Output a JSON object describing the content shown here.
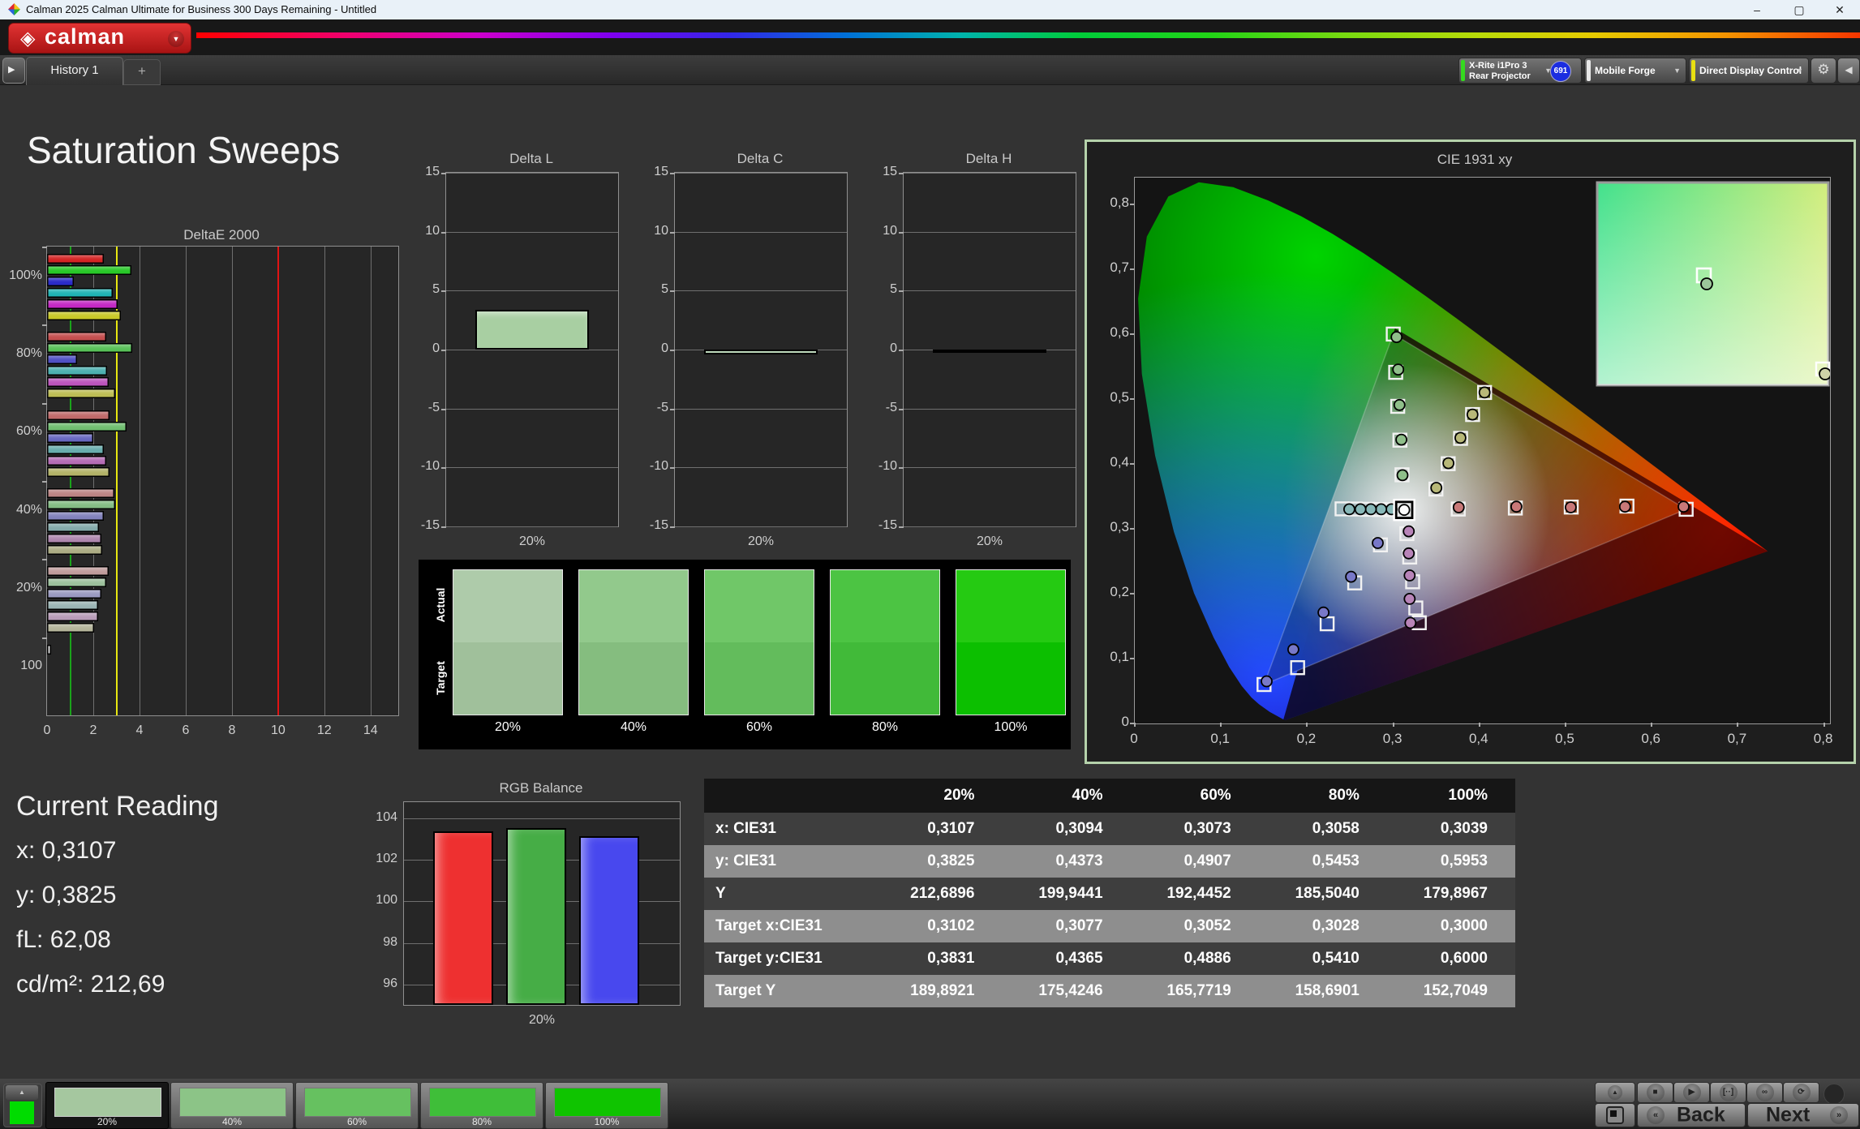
{
  "window": {
    "title": "Calman 2025 Calman Ultimate for Business 300 Days Remaining  - Untitled",
    "minimize_icon": "–",
    "maximize_icon": "▢",
    "close_icon": "✕"
  },
  "brand": {
    "name": "calman",
    "diamond_icon": "◈",
    "dropdown_icon": "▼"
  },
  "toolbar": {
    "expand_icon": "▶",
    "history_tab": "History 1",
    "add_tab": "+",
    "meter": {
      "line1": "X-Rite i1Pro 3",
      "line2": "Rear Projector",
      "badge": "691",
      "stripe_color": "#35d91f"
    },
    "source": {
      "label": "Mobile Forge",
      "stripe_color": "#e8e8e8"
    },
    "display_control": {
      "label": "Direct Display Control",
      "stripe_color": "#e8df12"
    },
    "settings_icon": "⚙",
    "collapse_icon": "◀"
  },
  "page": {
    "title": "Saturation Sweeps"
  },
  "current_reading": {
    "title": "Current Reading",
    "lines": [
      "x: 0,3107",
      "y: 0,3825",
      "fL: 62,08",
      "cd/m²: 212,69"
    ]
  },
  "swatch_compare": {
    "actual_label": "Actual",
    "target_label": "Target",
    "items": [
      {
        "label": "20%",
        "actual": "#aecbaa",
        "target": "#a0c09b"
      },
      {
        "label": "40%",
        "actual": "#92c98c",
        "target": "#85bd7f"
      },
      {
        "label": "60%",
        "actual": "#70c768",
        "target": "#63bc5c"
      },
      {
        "label": "80%",
        "actual": "#4cc443",
        "target": "#41ba39"
      },
      {
        "label": "100%",
        "actual": "#25ca12",
        "target": "#0cbf00"
      }
    ]
  },
  "table": {
    "headers": [
      "",
      "20%",
      "40%",
      "60%",
      "80%",
      "100%"
    ],
    "rows": [
      {
        "label": "x: CIE31",
        "values": [
          "0,3107",
          "0,3094",
          "0,3073",
          "0,3058",
          "0,3039"
        ]
      },
      {
        "label": "y: CIE31",
        "values": [
          "0,3825",
          "0,4373",
          "0,4907",
          "0,5453",
          "0,5953"
        ]
      },
      {
        "label": "Y",
        "values": [
          "212,6896",
          "199,9441",
          "192,4452",
          "185,5040",
          "179,8967"
        ]
      },
      {
        "label": "Target x:CIE31",
        "values": [
          "0,3102",
          "0,3077",
          "0,3052",
          "0,3028",
          "0,3000"
        ]
      },
      {
        "label": "Target y:CIE31",
        "values": [
          "0,3831",
          "0,4365",
          "0,4886",
          "0,5410",
          "0,6000"
        ]
      },
      {
        "label": "Target Y",
        "values": [
          "189,8921",
          "175,4246",
          "165,7719",
          "158,6901",
          "152,7049"
        ]
      }
    ]
  },
  "footer": {
    "swatch_buttons": [
      {
        "label": "20%",
        "color": "#a5c79f",
        "selected": true
      },
      {
        "label": "40%",
        "color": "#8cc487",
        "selected": false
      },
      {
        "label": "60%",
        "color": "#66c160",
        "selected": false
      },
      {
        "label": "80%",
        "color": "#3fbe39",
        "selected": false
      },
      {
        "label": "100%",
        "color": "#0fc400",
        "selected": false
      }
    ],
    "up_icon": "▲",
    "stop_square_icon": "■",
    "transport_icons": [
      {
        "name": "stop",
        "glyph": "■"
      },
      {
        "name": "play",
        "glyph": "▶"
      },
      {
        "name": "read-series",
        "glyph": "[··]"
      },
      {
        "name": "continuous",
        "glyph": "∞"
      },
      {
        "name": "refresh",
        "glyph": "⟳"
      }
    ],
    "back_arrow": "«",
    "back_label": "Back",
    "next_label": "Next",
    "next_arrow": "»",
    "target_color": "#00dc00"
  },
  "chart_data": [
    {
      "id": "deltae2000",
      "type": "bar",
      "orientation": "horizontal",
      "title": "DeltaE 2000",
      "xlim": [
        0,
        15.2
      ],
      "xticks": [
        0,
        2,
        4,
        6,
        8,
        10,
        12,
        14
      ],
      "reference_lines": [
        {
          "value": 1,
          "color": "#1aa31a"
        },
        {
          "value": 3,
          "color": "#e8e810"
        },
        {
          "value": 10,
          "color": "#e01414"
        }
      ],
      "groups": [
        {
          "label": "100%",
          "bars": [
            {
              "name": "red",
              "value": 2.45,
              "color": "#d42424"
            },
            {
              "name": "green",
              "value": 3.65,
              "color": "#28c828"
            },
            {
              "name": "blue",
              "value": 1.15,
              "color": "#2a2ac8"
            },
            {
              "name": "cyan",
              "value": 2.85,
              "color": "#20b4b4"
            },
            {
              "name": "magenta",
              "value": 3.05,
              "color": "#c428c4"
            },
            {
              "name": "yellow",
              "value": 3.2,
              "color": "#c8c828"
            }
          ]
        },
        {
          "label": "80%",
          "bars": [
            {
              "name": "red",
              "value": 2.55,
              "color": "#c44e4e"
            },
            {
              "name": "green",
              "value": 3.7,
              "color": "#58c058"
            },
            {
              "name": "blue",
              "value": 1.3,
              "color": "#5050c4"
            },
            {
              "name": "cyan",
              "value": 2.6,
              "color": "#4cb0b0"
            },
            {
              "name": "magenta",
              "value": 2.65,
              "color": "#bc54bc"
            },
            {
              "name": "yellow",
              "value": 2.95,
              "color": "#bcbc54"
            }
          ]
        },
        {
          "label": "60%",
          "bars": [
            {
              "name": "red",
              "value": 2.7,
              "color": "#c06a6a"
            },
            {
              "name": "green",
              "value": 3.45,
              "color": "#70be70"
            },
            {
              "name": "blue",
              "value": 2.0,
              "color": "#6868c0"
            },
            {
              "name": "cyan",
              "value": 2.45,
              "color": "#68adad"
            },
            {
              "name": "magenta",
              "value": 2.55,
              "color": "#b56cb5"
            },
            {
              "name": "yellow",
              "value": 2.7,
              "color": "#b3b368"
            }
          ]
        },
        {
          "label": "40%",
          "bars": [
            {
              "name": "red",
              "value": 2.9,
              "color": "#bc8484"
            },
            {
              "name": "green",
              "value": 2.95,
              "color": "#84bc84"
            },
            {
              "name": "blue",
              "value": 2.45,
              "color": "#8282bc"
            },
            {
              "name": "cyan",
              "value": 2.25,
              "color": "#84aaaa"
            },
            {
              "name": "magenta",
              "value": 2.35,
              "color": "#ae86ae"
            },
            {
              "name": "yellow",
              "value": 2.4,
              "color": "#acac84"
            }
          ]
        },
        {
          "label": "20%",
          "bars": [
            {
              "name": "red",
              "value": 2.65,
              "color": "#c09c9c"
            },
            {
              "name": "green",
              "value": 2.55,
              "color": "#9cc09c"
            },
            {
              "name": "blue",
              "value": 2.35,
              "color": "#9a9ac0"
            },
            {
              "name": "cyan",
              "value": 2.2,
              "color": "#9ab4b4"
            },
            {
              "name": "magenta",
              "value": 2.2,
              "color": "#b89cb8"
            },
            {
              "name": "yellow",
              "value": 2.05,
              "color": "#b4b49a"
            }
          ]
        },
        {
          "label": "100",
          "bars": [
            {
              "name": "white",
              "value": 0.18,
              "color": "#d8d8d8"
            }
          ]
        }
      ]
    },
    {
      "id": "deltaL",
      "type": "bar",
      "title": "Delta L",
      "categories": [
        "20%"
      ],
      "values": [
        3.4
      ],
      "ylim": [
        -15,
        15
      ],
      "yticks": [
        15,
        10,
        5,
        0,
        -5,
        -10,
        -15
      ],
      "bar_color": "#a8cfa2"
    },
    {
      "id": "deltaC",
      "type": "bar",
      "title": "Delta C",
      "categories": [
        "20%"
      ],
      "values": [
        -0.4
      ],
      "ylim": [
        -15,
        15
      ],
      "yticks": [
        15,
        10,
        5,
        0,
        -5,
        -10,
        -15
      ],
      "bar_color": "#9cc79a"
    },
    {
      "id": "deltaH",
      "type": "bar",
      "title": "Delta H",
      "categories": [
        "20%"
      ],
      "values": [
        -0.15
      ],
      "ylim": [
        -15,
        15
      ],
      "yticks": [
        15,
        10,
        5,
        0,
        -5,
        -10,
        -15
      ],
      "bar_color": "#0a0a0a"
    },
    {
      "id": "rgb_balance",
      "type": "bar",
      "title": "RGB Balance",
      "categories": [
        "20%"
      ],
      "ylim": [
        95,
        104.8
      ],
      "yticks": [
        96,
        98,
        100,
        102,
        104
      ],
      "series": [
        {
          "name": "Red",
          "value": 103.4,
          "color": "#ee3030"
        },
        {
          "name": "Green",
          "value": 103.55,
          "color": "#46ad46"
        },
        {
          "name": "Blue",
          "value": 103.15,
          "color": "#4848ee"
        }
      ]
    },
    {
      "id": "cie1931",
      "type": "scatter",
      "title": "CIE 1931 xy",
      "xlim": [
        0,
        0.807
      ],
      "ylim": [
        0,
        0.841
      ],
      "xticks": [
        0,
        0.1,
        0.2,
        0.3,
        0.4,
        0.5,
        0.6,
        0.7,
        0.8
      ],
      "xtick_labels": [
        "0",
        "0,1",
        "0,2",
        "0,3",
        "0,4",
        "0,5",
        "0,6",
        "0,7",
        "0,8"
      ],
      "yticks": [
        0,
        0.1,
        0.2,
        0.3,
        0.4,
        0.5,
        0.6,
        0.7,
        0.8
      ],
      "ytick_labels": [
        "0",
        "0,1",
        "0,2",
        "0,3",
        "0,4",
        "0,5",
        "0,6",
        "0,7",
        "0,8"
      ],
      "srgb_triangle": [
        [
          0.64,
          0.33
        ],
        [
          0.3,
          0.6
        ],
        [
          0.15,
          0.06
        ]
      ],
      "native_triangle": [
        [
          0.735,
          0.265
        ],
        [
          0.302,
          0.609
        ],
        [
          0.172,
          0.004
        ]
      ],
      "white_point": {
        "x": 0.3127,
        "y": 0.329
      },
      "sweeps": [
        {
          "name": "green",
          "color": "#8fbf8a",
          "measured": [
            [
              0.3107,
              0.3825
            ],
            [
              0.3094,
              0.4373
            ],
            [
              0.3073,
              0.4907
            ],
            [
              0.3058,
              0.5453
            ],
            [
              0.3039,
              0.5953
            ]
          ],
          "targets": [
            [
              0.3102,
              0.3831
            ],
            [
              0.3077,
              0.4365
            ],
            [
              0.3052,
              0.4886
            ],
            [
              0.3028,
              0.541
            ],
            [
              0.3,
              0.6
            ]
          ]
        },
        {
          "name": "red",
          "color": "#c87878",
          "measured": [
            [
              0.376,
              0.333
            ],
            [
              0.443,
              0.334
            ],
            [
              0.506,
              0.333
            ],
            [
              0.569,
              0.334
            ],
            [
              0.637,
              0.334
            ]
          ],
          "targets": [
            [
              0.3754,
              0.3304
            ],
            [
              0.4417,
              0.3319
            ],
            [
              0.5066,
              0.3334
            ],
            [
              0.5713,
              0.3349
            ],
            [
              0.64,
              0.33
            ]
          ]
        },
        {
          "name": "blue",
          "color": "#7878c8",
          "measured": [
            [
              0.282,
              0.278
            ],
            [
              0.251,
              0.226
            ],
            [
              0.219,
              0.171
            ],
            [
              0.184,
              0.114
            ],
            [
              0.153,
              0.065
            ]
          ],
          "targets": [
            [
              0.2851,
              0.2752
            ],
            [
              0.2553,
              0.2165
            ],
            [
              0.2233,
              0.1536
            ],
            [
              0.189,
              0.086
            ],
            [
              0.15,
              0.06
            ]
          ]
        },
        {
          "name": "cyan",
          "color": "#88b8b8",
          "measured": [
            [
              0.298,
              0.33
            ],
            [
              0.286,
              0.33
            ],
            [
              0.274,
              0.33
            ],
            [
              0.262,
              0.33
            ],
            [
              0.249,
              0.33
            ]
          ],
          "targets": [
            [
              0.2968,
              0.3294
            ],
            [
              0.2838,
              0.3297
            ],
            [
              0.2702,
              0.33
            ],
            [
              0.256,
              0.3304
            ],
            [
              0.2406,
              0.3307
            ]
          ]
        },
        {
          "name": "magenta",
          "color": "#b884b8",
          "measured": [
            [
              0.318,
              0.296
            ],
            [
              0.318,
              0.262
            ],
            [
              0.319,
              0.228
            ],
            [
              0.319,
              0.192
            ],
            [
              0.32,
              0.155
            ]
          ],
          "targets": [
            [
              0.3158,
              0.2925
            ],
            [
              0.3191,
              0.2564
            ],
            [
              0.3225,
              0.2183
            ],
            [
              0.3262,
              0.178
            ],
            [
              0.3302,
              0.1552
            ]
          ]
        },
        {
          "name": "yellow",
          "color": "#b8b878",
          "measured": [
            [
              0.35,
              0.363
            ],
            [
              0.364,
              0.401
            ],
            [
              0.378,
              0.44
            ],
            [
              0.392,
              0.476
            ],
            [
              0.406,
              0.51
            ]
          ],
          "targets": [
            [
              0.3495,
              0.3612
            ],
            [
              0.3638,
              0.4003
            ],
            [
              0.3782,
              0.4392
            ],
            [
              0.3921,
              0.476
            ],
            [
              0.406,
              0.51
            ]
          ]
        }
      ]
    }
  ]
}
